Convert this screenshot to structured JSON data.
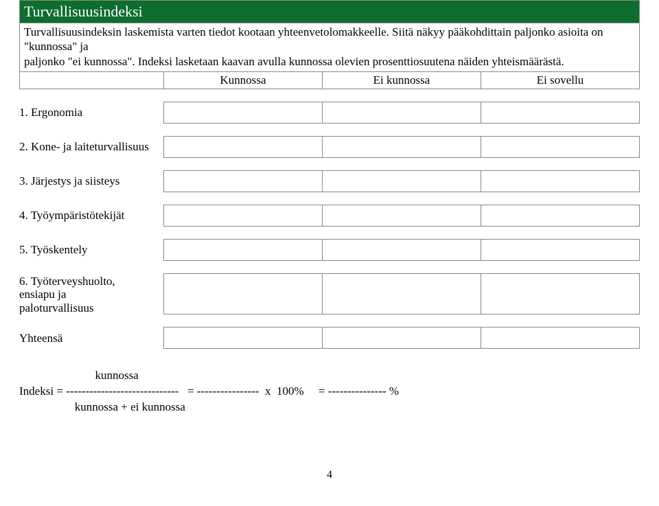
{
  "title": "Turvallisuusindeksi",
  "intro_line1": "Turvallisuusindeksin laskemista varten tiedot kootaan yhteenvetolomakkeelle. Siitä näkyy pääkohdittain paljonko asioita on \"kunnossa\" ja",
  "intro_line2": "paljonko \"ei kunnossa\". Indeksi lasketaan kaavan avulla kunnossa olevien prosenttiosuutena näiden yhteismäärästä.",
  "headers": {
    "col1": "Kunnossa",
    "col2": "Ei kunnossa",
    "col3": "Ei sovellu"
  },
  "rows": [
    {
      "label": "1. Ergonomia",
      "tall": false
    },
    {
      "label": "2. Kone- ja laiteturvallisuus",
      "tall": false
    },
    {
      "label": "3. Järjestys ja siisteys",
      "tall": false
    },
    {
      "label": "4. Työympäristötekijät",
      "tall": false
    },
    {
      "label": "5. Työskentely",
      "tall": false
    },
    {
      "label": "6. Työterveyshuolto,\n    ensiapu ja\n    paloturvallisuus",
      "tall": true
    },
    {
      "label": "Yhteensä",
      "tall": false
    }
  ],
  "formula": "                          kunnossa\nIndeksi = -----------------------------   = ----------------  x  100%     = --------------- %\n                   kunnossa + ei kunnossa",
  "page_number": "4"
}
